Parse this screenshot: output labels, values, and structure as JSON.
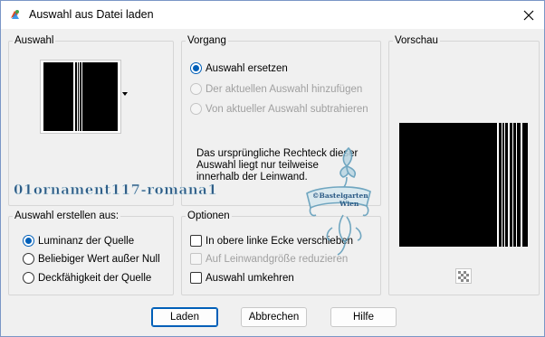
{
  "window": {
    "title": "Auswahl aus Datei laden",
    "close_icon": "close-icon",
    "app_icon": "paintshop-icon"
  },
  "auswahl": {
    "group_label": "Auswahl",
    "thumbnail_icon": "selection-thumbnail",
    "dropdown_icon": "dropdown-arrow-icon"
  },
  "vorgang": {
    "group_label": "Vorgang",
    "options": [
      {
        "label": "Auswahl ersetzen",
        "checked": true,
        "enabled": true
      },
      {
        "label": "Der aktuellen Auswahl hinzufügen",
        "checked": false,
        "enabled": false
      },
      {
        "label": "Von aktueller Auswahl subtrahieren",
        "checked": false,
        "enabled": false
      }
    ],
    "note": "Das ursprüngliche Rechteck dieser Auswahl liegt nur teilweise innerhalb der Leinwand.",
    "note_lines": [
      "Das ursprüngliche Rechteck dieser",
      "Auswahl liegt nur teilweise",
      "innerhalb der Leinwand."
    ]
  },
  "vorschau": {
    "group_label": "Vorschau",
    "transparency_icon": "transparency-toggle-icon"
  },
  "erstellen": {
    "group_label": "Auswahl erstellen aus:",
    "options": [
      {
        "label": "Luminanz der Quelle",
        "checked": true
      },
      {
        "label": "Beliebiger Wert außer Null",
        "checked": false
      },
      {
        "label": "Deckfähigkeit der Quelle",
        "checked": false
      }
    ]
  },
  "optionen": {
    "group_label": "Optionen",
    "options": [
      {
        "label": "In obere linke Ecke verschieben",
        "checked": false,
        "enabled": true
      },
      {
        "label": "Auf Leinwandgröße reduzieren",
        "checked": false,
        "enabled": false
      },
      {
        "label": "Auswahl umkehren",
        "checked": false,
        "enabled": true
      }
    ]
  },
  "buttons": {
    "laden": "Laden",
    "abbrechen": "Abbrechen",
    "hilfe": "Hilfe"
  },
  "watermark": {
    "filename_text": "01ornament117-romana1",
    "stamp_text_1": "©Bastelgarten",
    "stamp_text_2": "Wien"
  },
  "colors": {
    "accent": "#005fb8",
    "watermark_text": "#2b5a85"
  }
}
